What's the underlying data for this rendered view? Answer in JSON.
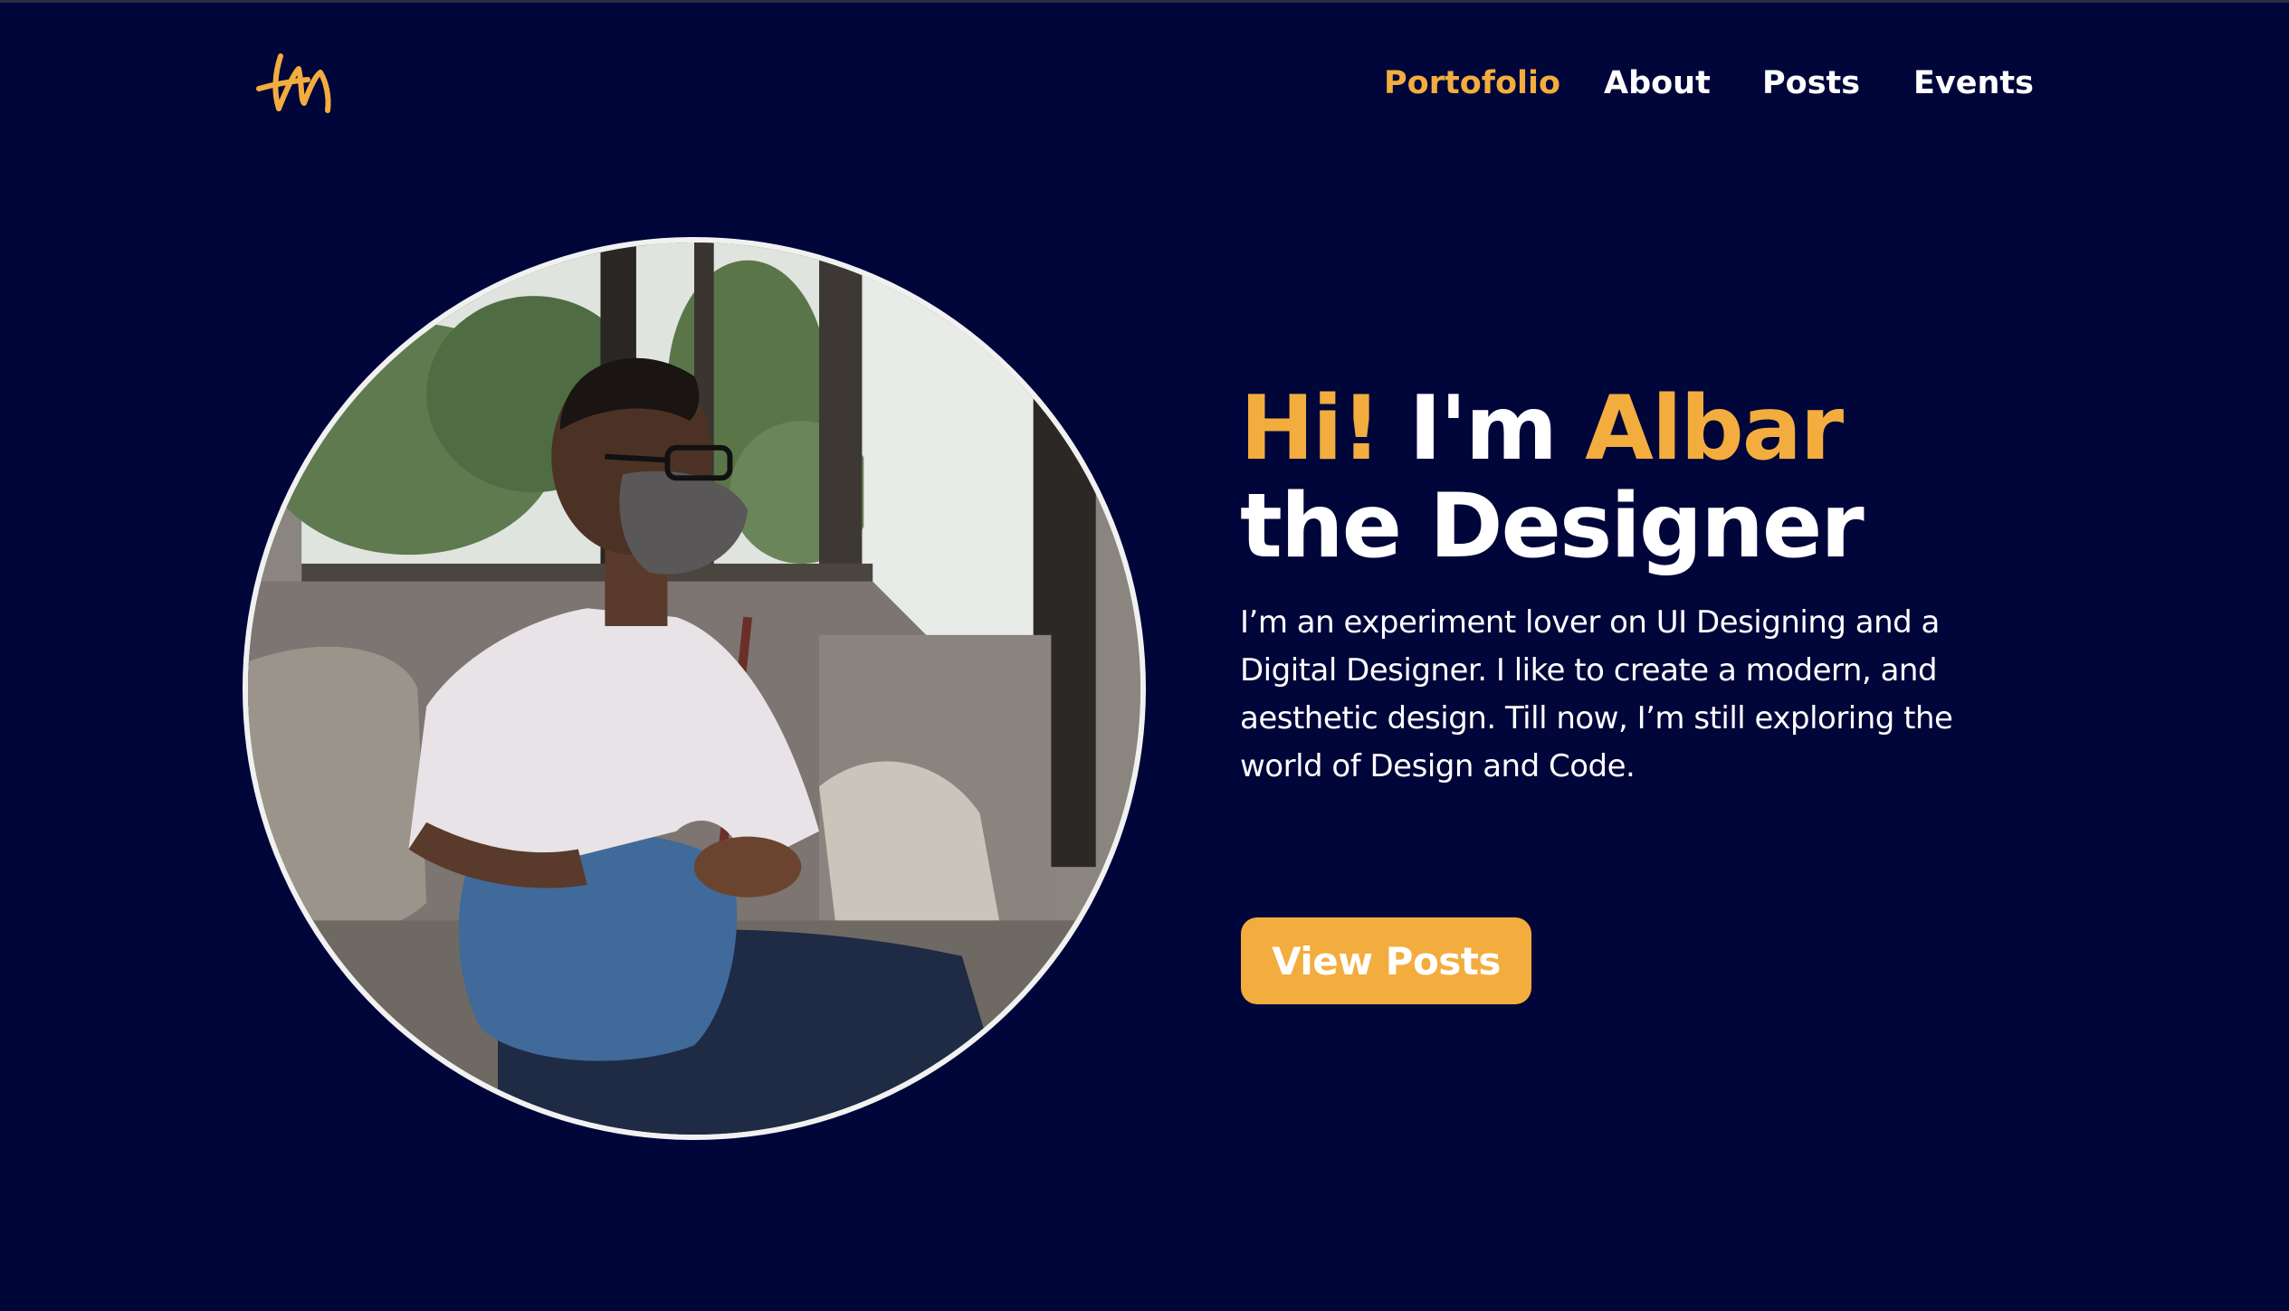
{
  "brand": {
    "logo_icon": "am-monogram-logo",
    "accent_color": "#f2ad3e",
    "background_color": "#00053a"
  },
  "nav": {
    "items": [
      {
        "label": "Portofolio",
        "active": true
      },
      {
        "label": "About",
        "active": false
      },
      {
        "label": "Posts",
        "active": false
      },
      {
        "label": "Events",
        "active": false
      }
    ]
  },
  "hero": {
    "greeting": "Hi!",
    "intro": "I'm",
    "name": "Albar",
    "role_line": "the Designer",
    "description": "I’m an experiment lover on UI Designing and a Digital Designer. I like to create a modern, and aesthetic design. Till now, I’m still exploring the world of Design and Code.",
    "cta_label": "View Posts"
  }
}
